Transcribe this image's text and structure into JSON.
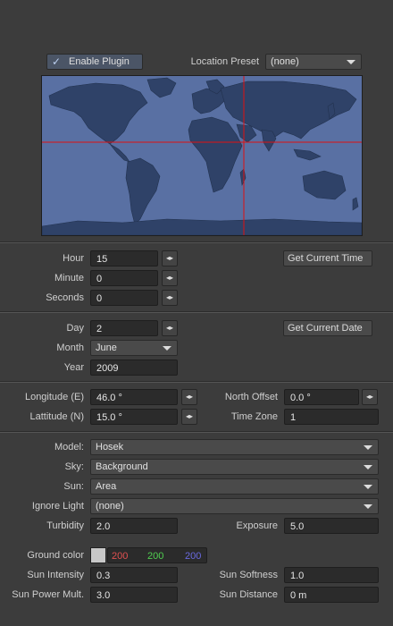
{
  "plugin": {
    "enable_label": "Enable Plugin",
    "enabled": true
  },
  "location_preset": {
    "label": "Location Preset",
    "value": "(none)"
  },
  "map": {
    "crosshair_color": "#e01010",
    "ocean_color": "#5970a3",
    "land_color": "#2f4268"
  },
  "time": {
    "hour_label": "Hour",
    "hour": "15",
    "minute_label": "Minute",
    "minute": "0",
    "seconds_label": "Seconds",
    "seconds": "0",
    "get_current_time": "Get Current Time"
  },
  "date": {
    "day_label": "Day",
    "day": "2",
    "month_label": "Month",
    "month": "June",
    "year_label": "Year",
    "year": "2009",
    "get_current_date": "Get Current Date"
  },
  "location": {
    "longitude_label": "Longitude (E)",
    "longitude": "46.0 °",
    "latitude_label": "Lattitude (N)",
    "latitude": "15.0 °",
    "north_offset_label": "North Offset",
    "north_offset": "0.0 °",
    "time_zone_label": "Time Zone",
    "time_zone": "1"
  },
  "sky": {
    "model_label": "Model:",
    "model": "Hosek",
    "sky_label": "Sky:",
    "sky": "Background",
    "sun_label": "Sun:",
    "sun": "Area",
    "ignore_light_label": "Ignore Light",
    "ignore_light": "(none)",
    "turbidity_label": "Turbidity",
    "turbidity": "2.0",
    "exposure_label": "Exposure",
    "exposure": "5.0"
  },
  "ground": {
    "label": "Ground color",
    "r": "200",
    "g": "200",
    "b": "200",
    "swatch_color": "#c8c8c8",
    "r_color": "#e05050",
    "g_color": "#50d050",
    "b_color": "#6a6ae0"
  },
  "sun_params": {
    "intensity_label": "Sun Intensity",
    "intensity": "0.3",
    "softness_label": "Sun Softness",
    "softness": "1.0",
    "power_label": "Sun Power Mult.",
    "power": "3.0",
    "distance_label": "Sun Distance",
    "distance": "0 m"
  }
}
